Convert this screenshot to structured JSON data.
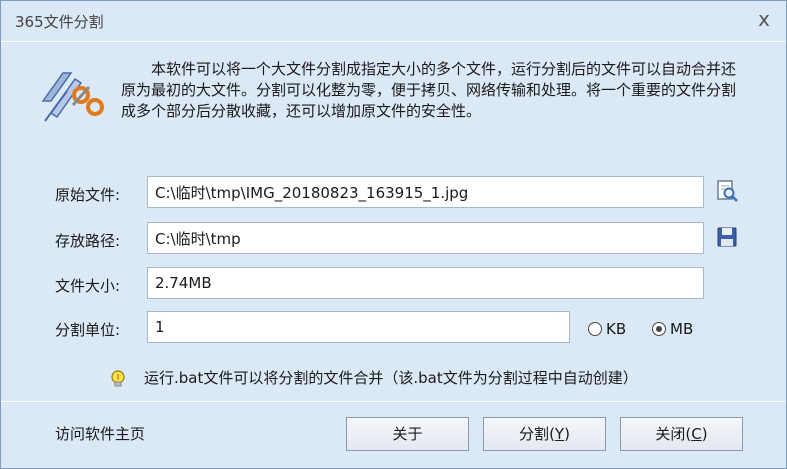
{
  "window": {
    "title": "365文件分割",
    "close_label": "x"
  },
  "description": "本软件可以将一个大文件分割成指定大小的多个文件，运行分割后的文件可以自动合并还原为最初的大文件。分割可以化整为零，便于拷贝、网络传输和处理。将一个重要的文件分割成多个部分后分散收藏，还可以增加原文件的安全性。",
  "form": {
    "source_label": "原始文件:",
    "source_value": "C:\\临时\\tmp\\IMG_20180823_163915_1.jpg",
    "dest_label": "存放路径:",
    "dest_value": "C:\\临时\\tmp",
    "size_label": "文件大小:",
    "size_value": "2.74MB",
    "unit_label": "分割单位:",
    "unit_value": "1",
    "unit_options": [
      {
        "label": "KB",
        "selected": false
      },
      {
        "label": "MB",
        "selected": true
      }
    ]
  },
  "hint": "运行.bat文件可以将分割的文件合并（该.bat文件为分割过程中自动创建）",
  "footer": {
    "homepage_link": "访问软件主页",
    "about_button": "关于",
    "split_button": "分割",
    "split_hotkey": "Y",
    "close_button": "关闭",
    "close_hotkey": "C"
  },
  "icons": {
    "app": "scissors-file-icon",
    "browse": "browse-file-icon",
    "save": "floppy-disk-icon",
    "hint": "lightbulb-icon"
  }
}
